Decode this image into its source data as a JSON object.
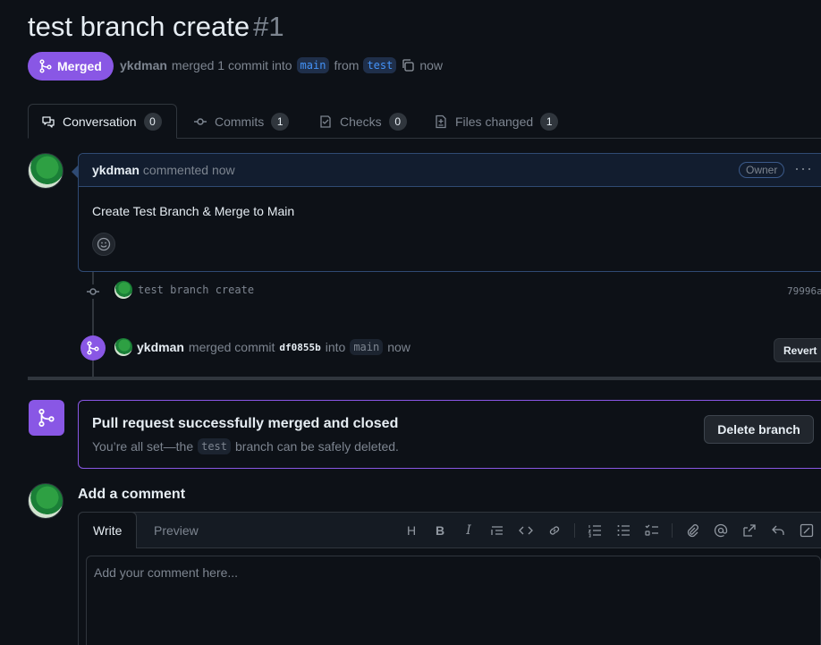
{
  "header": {
    "title": "test branch create",
    "number": "#1",
    "status_label": "Merged",
    "author": "ykdman",
    "merged_text": "merged 1 commit into",
    "base_branch": "main",
    "from_text": "from",
    "head_branch": "test",
    "time": "now"
  },
  "tabs": [
    {
      "label": "Conversation",
      "count": "0"
    },
    {
      "label": "Commits",
      "count": "1"
    },
    {
      "label": "Checks",
      "count": "0"
    },
    {
      "label": "Files changed",
      "count": "1"
    }
  ],
  "comment": {
    "author": "ykdman",
    "action": "commented now",
    "role": "Owner",
    "body": "Create Test Branch & Merge to Main"
  },
  "commit": {
    "message": "test branch create",
    "sha": "79996a"
  },
  "merge_event": {
    "author": "ykdman",
    "text": "merged commit",
    "hash": "df0855b",
    "into": "into",
    "branch": "main",
    "time": "now",
    "revert_label": "Revert"
  },
  "merged_box": {
    "title": "Pull request successfully merged and closed",
    "sub_prefix": "You’re all set—the",
    "branch": "test",
    "sub_suffix": "branch can be safely deleted.",
    "delete_label": "Delete branch"
  },
  "add_comment": {
    "title": "Add a comment",
    "write_tab": "Write",
    "preview_tab": "Preview",
    "placeholder": "Add your comment here...",
    "heading_tool": "H",
    "bold_tool": "B",
    "italic_tool": "I"
  },
  "colors": {
    "merged_purple": "#8957e5",
    "bg": "#0d1117",
    "border": "#30363d",
    "link_blue": "#4493f8"
  }
}
